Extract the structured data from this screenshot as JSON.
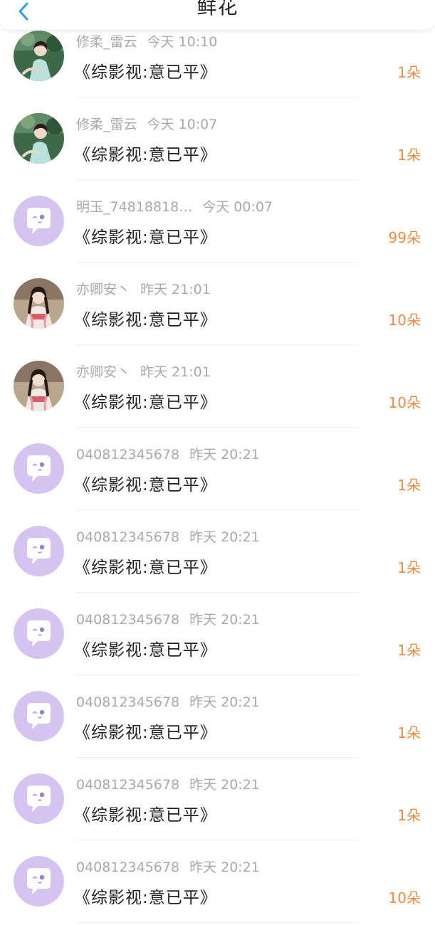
{
  "header": {
    "title": "鲜花",
    "back_icon": "chevron-left-icon",
    "accent": "#2f9ee8"
  },
  "colors": {
    "count": "#ef8a45",
    "meta": "#a9a9a9",
    "title": "#222222",
    "default_avatar": "#d6c3f2"
  },
  "items": [
    {
      "name": "修柔_雷云",
      "time": "今天 10:10",
      "book": "《综影视:意已平》",
      "count": "1朵",
      "avatar": "photo-green"
    },
    {
      "name": "修柔_雷云",
      "time": "今天 10:07",
      "book": "《综影视:意已平》",
      "count": "1朵",
      "avatar": "photo-green"
    },
    {
      "name": "明玉_74818818…",
      "time": "今天 00:07",
      "book": "《综影视:意已平》",
      "count": "99朵",
      "avatar": "default-chat"
    },
    {
      "name": "亦卿安丶",
      "time": "昨天 21:01",
      "book": "《综影视:意已平》",
      "count": "10朵",
      "avatar": "photo-pink"
    },
    {
      "name": "亦卿安丶",
      "time": "昨天 21:01",
      "book": "《综影视:意已平》",
      "count": "10朵",
      "avatar": "photo-pink"
    },
    {
      "name": "040812345678",
      "time": "昨天 20:21",
      "book": "《综影视:意已平》",
      "count": "1朵",
      "avatar": "default-chat"
    },
    {
      "name": "040812345678",
      "time": "昨天 20:21",
      "book": "《综影视:意已平》",
      "count": "1朵",
      "avatar": "default-chat"
    },
    {
      "name": "040812345678",
      "time": "昨天 20:21",
      "book": "《综影视:意已平》",
      "count": "1朵",
      "avatar": "default-chat"
    },
    {
      "name": "040812345678",
      "time": "昨天 20:21",
      "book": "《综影视:意已平》",
      "count": "1朵",
      "avatar": "default-chat"
    },
    {
      "name": "040812345678",
      "time": "昨天 20:21",
      "book": "《综影视:意已平》",
      "count": "1朵",
      "avatar": "default-chat"
    },
    {
      "name": "040812345678",
      "time": "昨天 20:21",
      "book": "《综影视:意已平》",
      "count": "10朵",
      "avatar": "default-chat"
    }
  ]
}
